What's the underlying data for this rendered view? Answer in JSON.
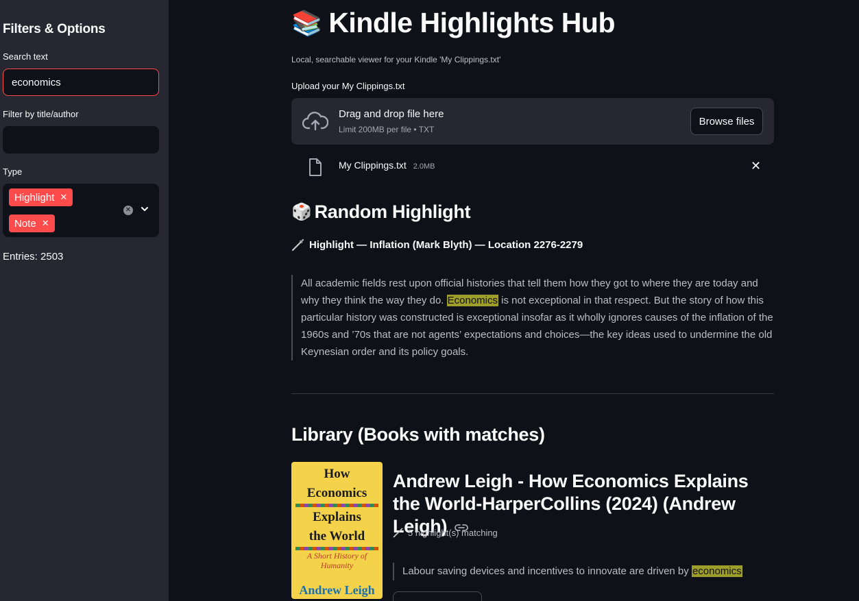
{
  "sidebar": {
    "title": "Filters & Options",
    "search": {
      "label": "Search text",
      "value": "economics"
    },
    "filter": {
      "label": "Filter by title/author",
      "value": ""
    },
    "type": {
      "label": "Type",
      "tags": [
        "Highlight",
        "Note"
      ]
    },
    "entries": "Entries: 2503"
  },
  "header": {
    "emoji": "📚",
    "title": "Kindle Highlights Hub",
    "caption": "Local, searchable viewer for your Kindle 'My Clippings.txt'"
  },
  "upload": {
    "label": "Upload your My Clippings.txt",
    "drop_title": "Drag and drop file here",
    "drop_sub": "Limit 200MB per file • TXT",
    "browse_label": "Browse files",
    "file_name": "My Clippings.txt",
    "file_size": "2.0MB"
  },
  "random": {
    "emoji": "🎲",
    "title": "Random Highlight",
    "meta": "Highlight — Inflation (Mark Blyth) — Location 2276-2279",
    "quote_before": "All academic fields rest upon official histories that tell them how they got to where they are today and why they think the way they do. ",
    "quote_mark": "Economics",
    "quote_after": " is not exceptional in that respect. But the story of how this particular history was constructed is exceptional insofar as it wholly ignores causes of the inflation of the 1960s and ’70s that are not agents’ expectations and choices—the key ideas used to undermine the old Keynesian order and its policy goals."
  },
  "library": {
    "title": "Library (Books with matches)",
    "book": {
      "cover_lines": [
        "How",
        "Economics",
        "Explains",
        "the World"
      ],
      "cover_subtitle": "A Short History of Humanity",
      "cover_author": "Andrew Leigh",
      "title": "Andrew Leigh - How Economics Explains the World-HarperCollins (2024) (Andrew Leigh)",
      "count": "5 highlight(s) matching",
      "quote_before": "Labour saving devices and incentives to innovate are driven by ",
      "quote_mark": "economics"
    }
  },
  "colors": {
    "accent": "#ff4b4b",
    "sidebar_bg": "#262730",
    "main_bg": "#0e1117",
    "highlight": "#9d9d2a"
  }
}
